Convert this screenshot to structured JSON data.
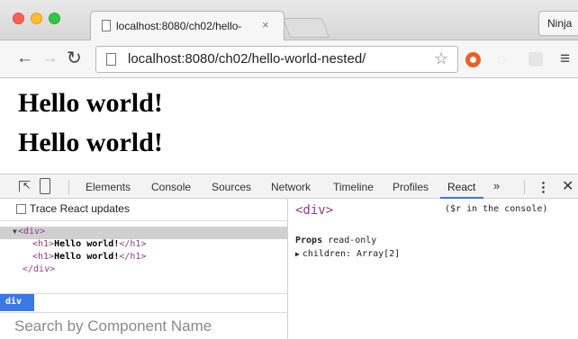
{
  "browser": {
    "tab_title": "localhost:8080/ch02/hello-",
    "tab_close": "×",
    "profile_name": "Ninja",
    "url": "localhost:8080/ch02/hello-world-nested/",
    "icons": [
      "back-arrow-icon",
      "forward-arrow-icon",
      "reload-icon",
      "page-icon",
      "star-icon",
      "extension-icon",
      "menu-icon"
    ]
  },
  "page": {
    "headings": [
      "Hello world!",
      "Hello world!"
    ]
  },
  "devtools": {
    "tabs": [
      "Elements",
      "Console",
      "Sources",
      "Network",
      "Timeline",
      "Profiles",
      "React"
    ],
    "active_tab": "React",
    "more": "»",
    "close": "✕",
    "trace_label": "Trace React updates",
    "tree": {
      "root_open": "<div>",
      "child1_open": "<h1>",
      "child1_text": "Hello world!",
      "child1_close": "</h1>",
      "child2_open": "<h1>",
      "child2_text": "Hello world!",
      "child2_close": "</h1>",
      "root_close": "</div>"
    },
    "breadcrumb": "div",
    "search_placeholder": "Search by Component Name",
    "selected_name": "<div>",
    "console_hint": "($r in the console)",
    "props_label": "Props",
    "props_note": "read-only",
    "children_prop": "children: Array[2]"
  }
}
